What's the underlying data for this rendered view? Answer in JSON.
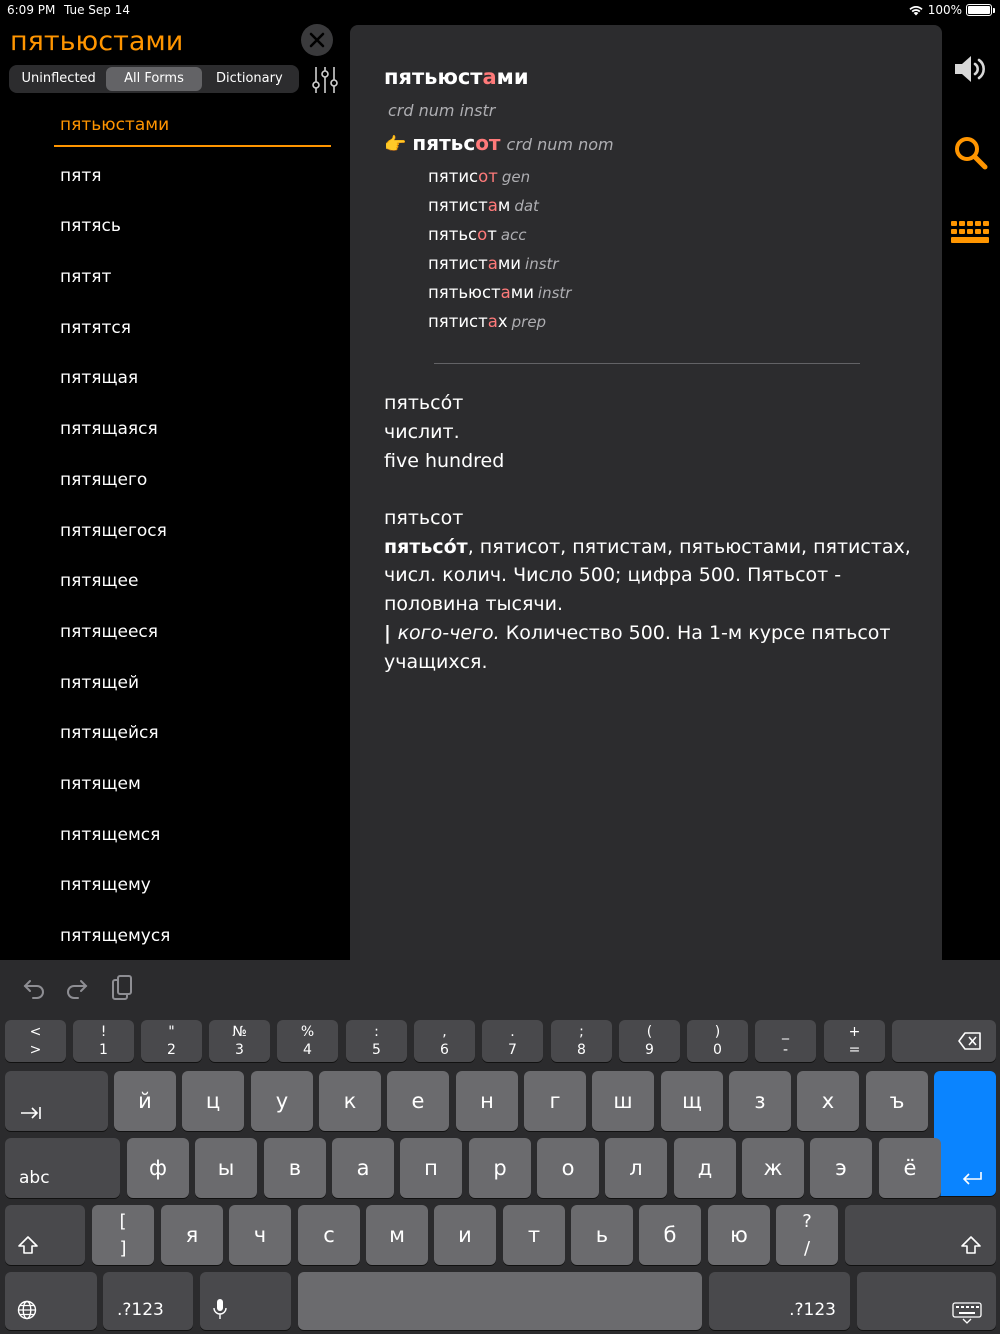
{
  "status": {
    "time": "6:09 PM",
    "date": "Tue Sep 14",
    "battery": "100%"
  },
  "search": {
    "query": "пятьюстами"
  },
  "segment": {
    "options": [
      "Uninflected",
      "All Forms",
      "Dictionary"
    ],
    "active_index": 1
  },
  "wordlist": [
    "пятьюстами",
    "пятя",
    "пятясь",
    "пятят",
    "пятятся",
    "пятящая",
    "пятящаяся",
    "пятящего",
    "пятящегося",
    "пятящее",
    "пятящееся",
    "пятящей",
    "пятящейся",
    "пятящем",
    "пятящемся",
    "пятящему",
    "пятящемуся"
  ],
  "entry": {
    "headword_pre": "пятьюст",
    "headword_hl": "а",
    "headword_post": "ми",
    "pos": "crd num instr",
    "hand": "👉",
    "lemma_pre": "пятьс",
    "lemma_hl": "от",
    "lemma_pos": "crd num nom",
    "forms": [
      {
        "pre": "пятис",
        "hl": "от",
        "post": "",
        "case": "gen"
      },
      {
        "pre": "пятист",
        "hl": "а",
        "post": "м",
        "case": "dat"
      },
      {
        "pre": "пятьс",
        "hl": "о",
        "post": "т",
        "case": "acc"
      },
      {
        "pre": "пятист",
        "hl": "а",
        "post": "ми",
        "case": "instr"
      },
      {
        "pre": "пятьюст",
        "hl": "а",
        "post": "ми",
        "case": "instr"
      },
      {
        "pre": "пятист",
        "hl": "а",
        "post": "х",
        "case": "prep"
      }
    ],
    "def1": {
      "word": "пятьсóт",
      "pos": "числит.",
      "gloss": "five hundred"
    },
    "def2": {
      "title": "пятьсот",
      "bold": "пятьсóт",
      "line1": ", пятисот, пятистам, пятьюстами, пятистах, числ. колич. Число 500; цифра 500. Пятьсот - половина тысячи.",
      "bar": "| ",
      "italic": "кого-чего.",
      "line2": " Количество 500. На 1-м курсе пятьсот учащихся."
    }
  },
  "keyboard": {
    "row1": [
      {
        "top": "<",
        "bot": ">"
      },
      {
        "top": "!",
        "bot": "1"
      },
      {
        "top": "\"",
        "bot": "2"
      },
      {
        "top": "№",
        "bot": "3"
      },
      {
        "top": "%",
        "bot": "4"
      },
      {
        "top": ":",
        "bot": "5"
      },
      {
        "top": ",",
        "bot": "6"
      },
      {
        "top": ".",
        "bot": "7"
      },
      {
        "top": ";",
        "bot": "8"
      },
      {
        "top": "(",
        "bot": "9"
      },
      {
        "top": ")",
        "bot": "0"
      },
      {
        "top": "_",
        "bot": "-"
      },
      {
        "top": "+",
        "bot": "="
      }
    ],
    "row2": [
      "й",
      "ц",
      "у",
      "к",
      "е",
      "н",
      "г",
      "ш",
      "щ",
      "з",
      "х",
      "ъ"
    ],
    "row3": [
      "ф",
      "ы",
      "в",
      "а",
      "п",
      "р",
      "о",
      "л",
      "д",
      "ж",
      "э",
      "ё"
    ],
    "row4": [
      "я",
      "ч",
      "с",
      "м",
      "и",
      "т",
      "ь",
      "б",
      "ю"
    ],
    "bracket_top": "[",
    "bracket_bot": "]",
    "slash_top": "?",
    "slash_bot": "/",
    "abc": "abc",
    "num_left": ".?123",
    "num_right": ".?123"
  }
}
